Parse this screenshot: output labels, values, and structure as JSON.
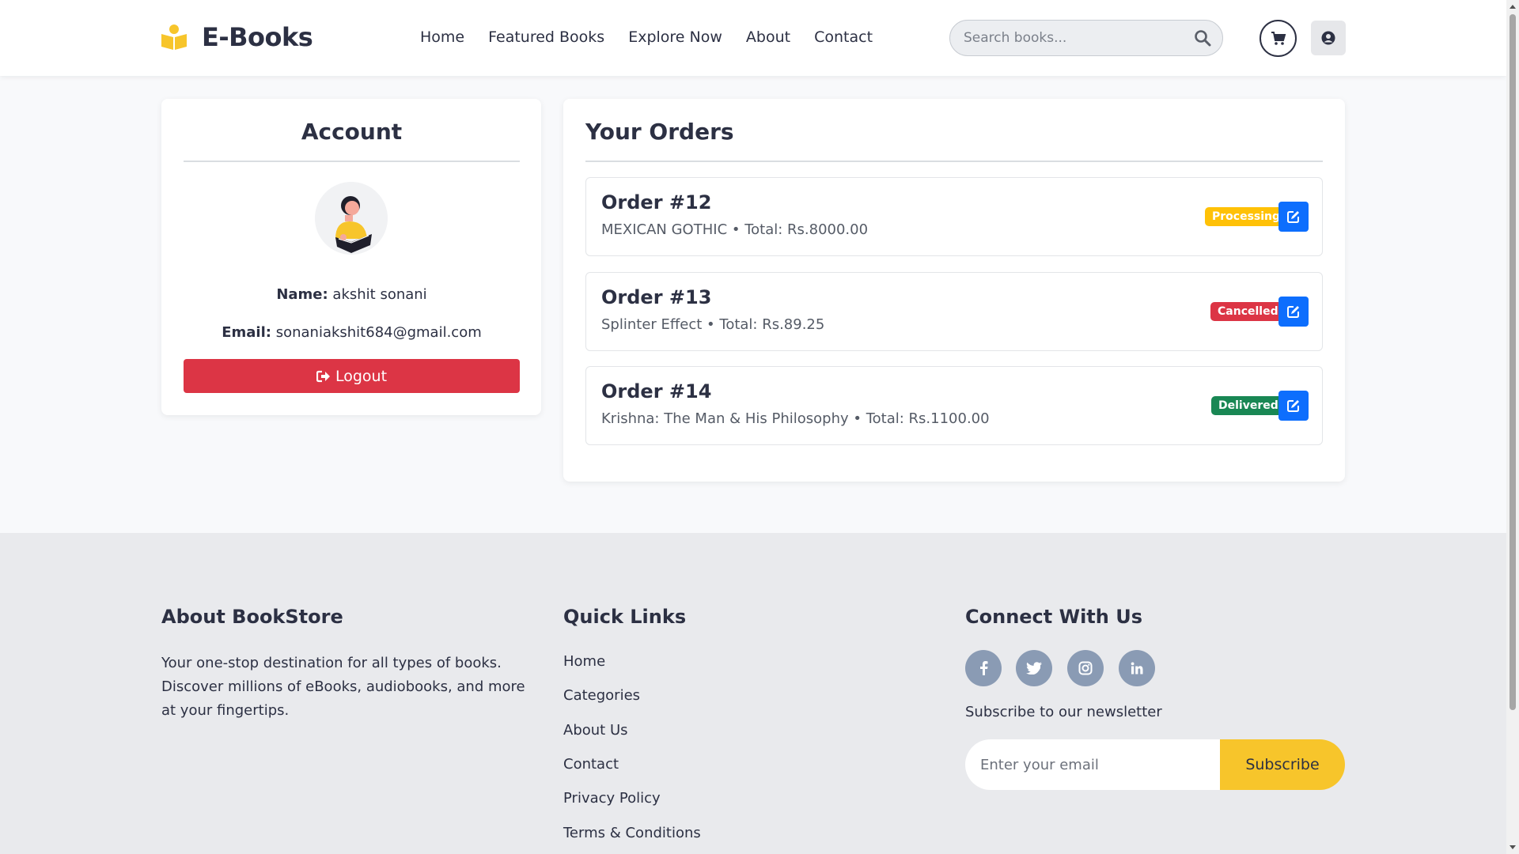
{
  "header": {
    "logo_text": "E-Books",
    "nav": [
      "Home",
      "Featured Books",
      "Explore Now",
      "About",
      "Contact"
    ],
    "search_placeholder": "Search books..."
  },
  "account": {
    "title": "Account",
    "name_label": "Name:",
    "name_value": "akshit sonani",
    "email_label": "Email:",
    "email_value": "sonaniakshit684@gmail.com",
    "logout_label": "Logout"
  },
  "orders": {
    "title": "Your Orders",
    "items": [
      {
        "title": "Order #12",
        "detail": "MEXICAN GOTHIC • Total: Rs.8000.00",
        "status": "Processing",
        "status_bg": "#ffc107",
        "status_fg": "#ffffff"
      },
      {
        "title": "Order #13",
        "detail": "Splinter Effect • Total: Rs.89.25",
        "status": "Cancelled",
        "status_bg": "#dc3545",
        "status_fg": "#ffffff"
      },
      {
        "title": "Order #14",
        "detail": "Krishna: The Man & His Philosophy • Total: Rs.1100.00",
        "status": "Delivered",
        "status_bg": "#198754",
        "status_fg": "#ffffff"
      }
    ]
  },
  "footer": {
    "about_heading": "About BookStore",
    "about_text": "Your one-stop destination for all types of books. Discover millions of eBooks, audiobooks, and more at your fingertips.",
    "links_heading": "Quick Links",
    "links": [
      "Home",
      "Categories",
      "About Us",
      "Contact",
      "Privacy Policy",
      "Terms & Conditions"
    ],
    "connect_heading": "Connect With Us",
    "social_icons": [
      "facebook-icon",
      "twitter-icon",
      "instagram-icon",
      "linkedin-icon"
    ],
    "newsletter_label": "Subscribe to our newsletter",
    "email_placeholder": "Enter your email",
    "subscribe_label": "Subscribe"
  },
  "colors": {
    "accent_yellow": "#f7c52b",
    "logout_red": "#dc3545",
    "edit_blue": "#0d6efd",
    "text_dark": "#2c3043"
  }
}
